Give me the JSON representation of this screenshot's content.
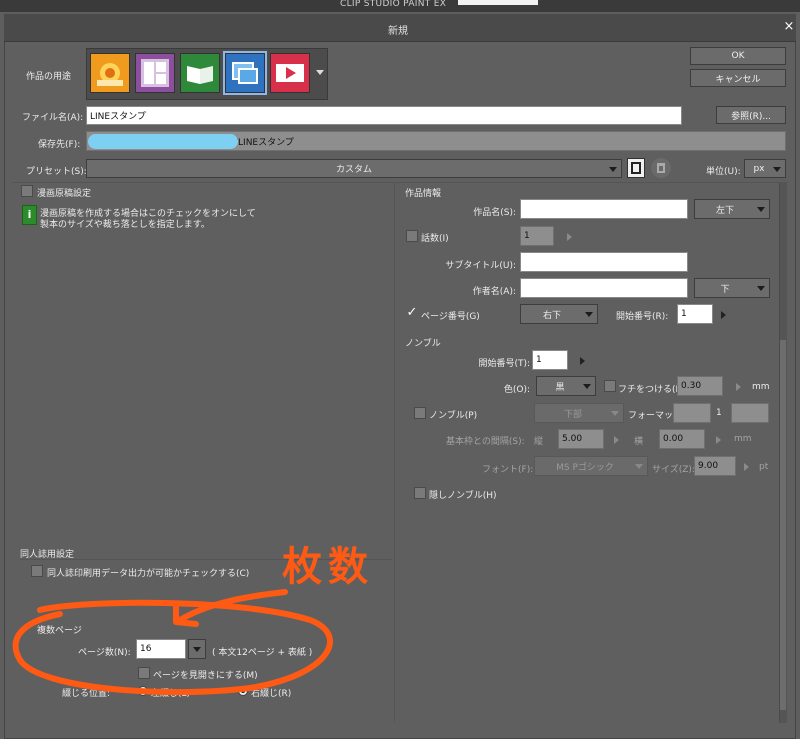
{
  "app": {
    "title": "CLIP STUDIO PAINT EX"
  },
  "dialog": {
    "title": "新規",
    "close_glyph": "×"
  },
  "usage": {
    "label": "作品の用途"
  },
  "buttons": {
    "ok": "OK",
    "cancel": "キャンセル",
    "browse": "参照(R)..."
  },
  "file": {
    "name_label": "ファイル名(A):",
    "name_value": "LINEスタンプ",
    "dest_label": "保存先(F):",
    "dest_value": "/LINEスタンプ"
  },
  "preset": {
    "label": "プリセット(S):",
    "value": "カスタム",
    "unit_label": "単位(U):",
    "unit_value": "px"
  },
  "manga": {
    "checkbox_label": "漫画原稿設定",
    "info_line1": "漫画原稿を作成する場合はこのチェックをオンにして",
    "info_line2": "製本のサイズや裁ち落としを指定します。"
  },
  "work_info": {
    "header": "作品情報",
    "title_label": "作品名(S):",
    "title_pos": "左下",
    "episode_label": "話数(I)",
    "episode_value": "1",
    "subtitle_label": "サブタイトル(U):",
    "author_label": "作者名(A):",
    "author_pos": "下",
    "page_no_label": "ページ番号(G)",
    "page_no_pos": "右下",
    "start_no_label": "開始番号(R):",
    "start_no_value": "1"
  },
  "nombre": {
    "header": "ノンブル",
    "start_label": "開始番号(T):",
    "start_value": "1",
    "color_label": "色(O):",
    "color_value": "黒",
    "border_label": "フチをつける(E)",
    "border_value": "0.30",
    "unit_mm": "mm",
    "nombre_label": "ノンブル(P)",
    "nombre_pos": "下部",
    "format_label": "フォーマット:",
    "format_value": "1",
    "distance_label": "基本枠との間隔(S):",
    "vertical_label": "縦",
    "vertical_value": "5.00",
    "horizontal_label": "横",
    "horizontal_value": "0.00",
    "font_label": "フォント(F):",
    "font_value": "MS Pゴシック",
    "size_label": "サイズ(Z):",
    "size_value": "9.00",
    "unit_pt": "pt",
    "hidden_label": "隠しノンブル(H)"
  },
  "doujin": {
    "header": "同人誌用設定",
    "check_label": "同人誌印刷用データ出力が可能かチェックする(C)"
  },
  "multi": {
    "label": "複数ページ",
    "pages_label": "ページ数(N):",
    "pages_value": "16",
    "pages_note": "( 本文12ページ + 表紙 )",
    "spread_label": "ページを見開きにする(M)",
    "binding_label": "綴じる位置:",
    "left_binding": "左綴じ(L)",
    "right_binding": "右綴じ(R)"
  },
  "annotation": {
    "text": "枚数",
    "color": "#ff5a14"
  },
  "icons": [
    "illustration-icon",
    "comic-icon",
    "book-icon",
    "photo-icon",
    "animation-icon"
  ],
  "colors": {
    "dialog_bg": "#5f5f5f",
    "titlebar": "#4a4a4a",
    "field_white": "#ffffff",
    "annotation": "#ff5a14"
  }
}
